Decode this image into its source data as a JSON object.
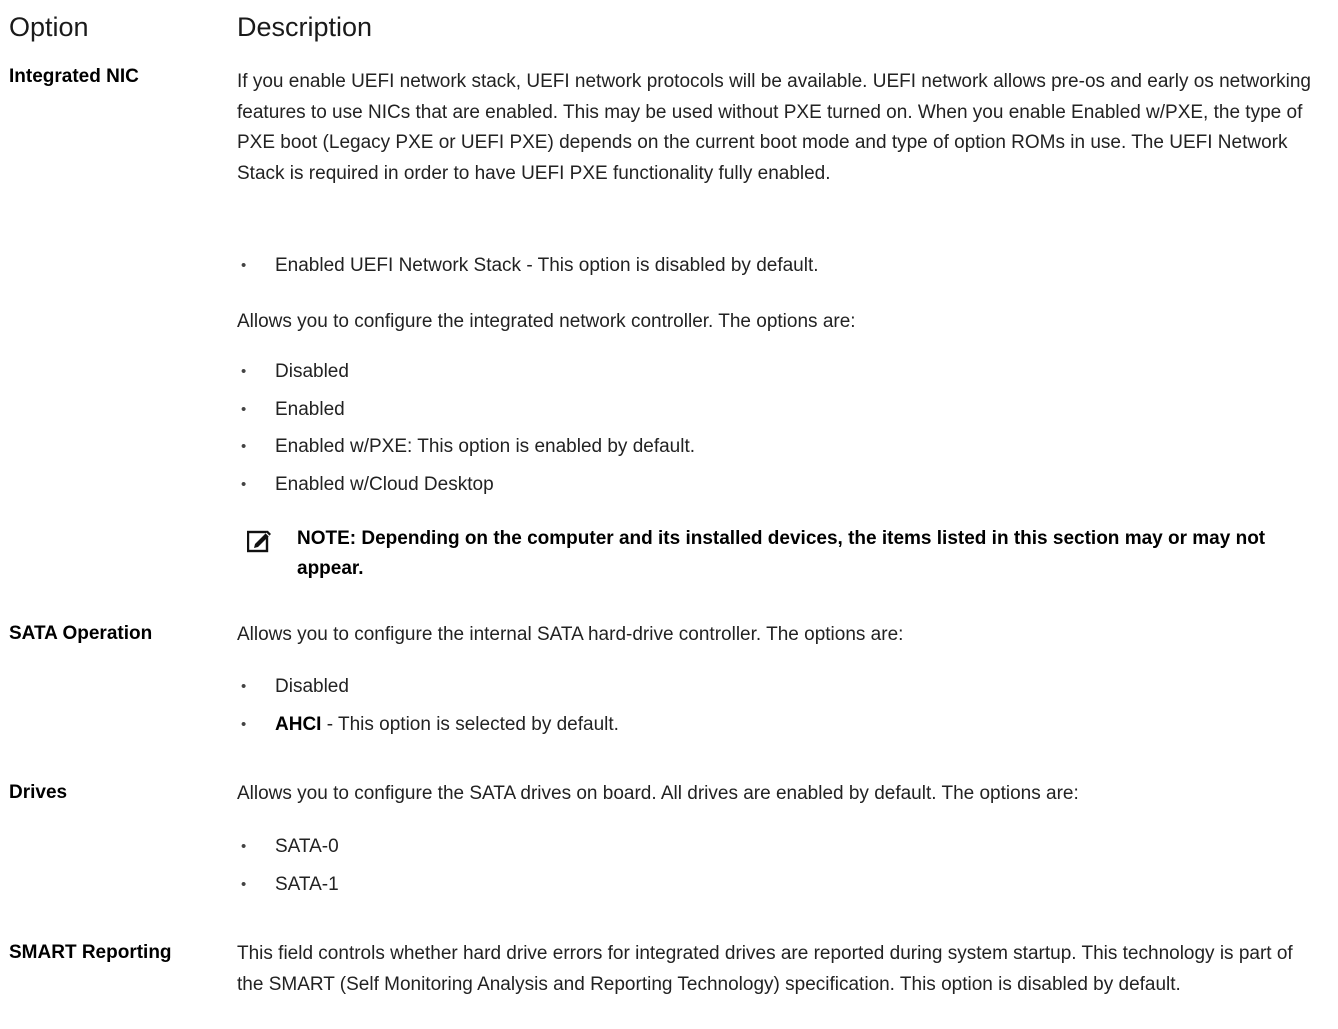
{
  "headers": {
    "option": "Option",
    "description": "Description"
  },
  "integrated_nic": {
    "name": "Integrated NIC",
    "paragraph1": "If you enable UEFI network stack, UEFI network protocols will be available. UEFI network allows pre-os and early os networking features to use NICs that are enabled. This may be used without PXE turned on. When you enable Enabled w/PXE, the type of PXE boot (Legacy PXE or UEFI PXE) depends on the current boot mode and type of option ROMs in use. The UEFI Network Stack is required in order to have UEFI PXE functionality fully enabled.",
    "stack_items": [
      "Enabled UEFI Network Stack - This option is disabled by default."
    ],
    "paragraph2": "Allows you to configure the integrated network controller. The options are:",
    "options": [
      "Disabled",
      "Enabled",
      "Enabled w/PXE: This option is enabled by default.",
      "Enabled w/Cloud Desktop"
    ],
    "note": "NOTE: Depending on the computer and its installed devices, the items listed in this section may or may not appear."
  },
  "sata_operation": {
    "name": "SATA Operation",
    "description": "Allows you to configure the internal SATA hard-drive controller. The options are:",
    "options": [
      {
        "bold": "",
        "text": "Disabled"
      },
      {
        "bold": "AHCI",
        "text": " - This option is selected by default."
      }
    ]
  },
  "drives": {
    "name": "Drives",
    "description": "Allows you to configure the SATA drives on board. All drives are enabled by default. The options are:",
    "options": [
      "SATA-0",
      "SATA-1"
    ]
  },
  "smart_reporting": {
    "name": "SMART Reporting",
    "description": "This field controls whether hard drive errors for integrated drives are reported during system startup. This technology is part of the SMART (Self Monitoring Analysis and Reporting Technology) specification. This option is disabled by default."
  },
  "icons": {
    "note": "pencil-note-icon"
  }
}
